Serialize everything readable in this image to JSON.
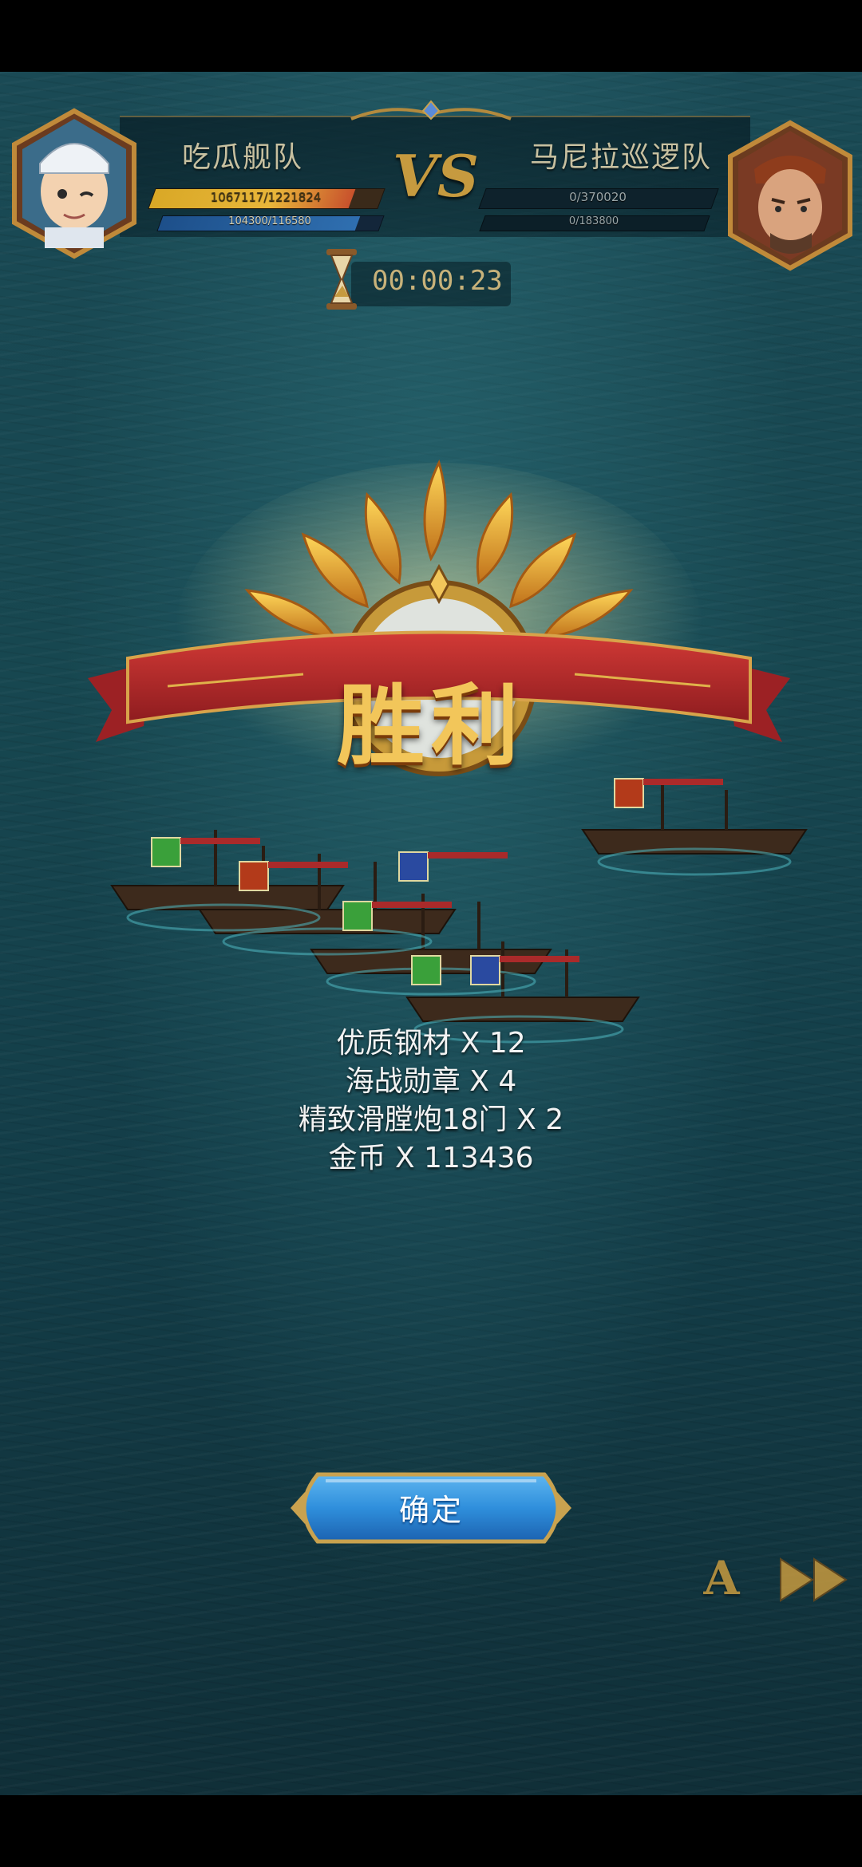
{
  "header": {
    "left_team": {
      "name": "吃瓜舰队",
      "hp_text": "1067117/1221824",
      "hp_fraction": 0.873,
      "sp_text": "104300/116580",
      "sp_fraction": 0.895,
      "avatar_icon": "chef-avatar-icon"
    },
    "vs_label": "VS",
    "right_team": {
      "name": "马尼拉巡逻队",
      "hp_text": "0/370020",
      "hp_fraction": 0,
      "sp_text": "0/183800",
      "sp_fraction": 0,
      "avatar_icon": "pirate-avatar-icon"
    }
  },
  "timer": {
    "value": "00:00:23",
    "icon": "hourglass-icon"
  },
  "result": {
    "title": "胜利"
  },
  "rewards": [
    {
      "text": "优质钢材 X 12"
    },
    {
      "text": "海战勋章 X 4"
    },
    {
      "text": "精致滑膛炮18门 X 2"
    },
    {
      "text": "金币 X 113436"
    }
  ],
  "confirm_button": {
    "label": "确定"
  },
  "controls": {
    "auto_label": "A",
    "speed_icon": "fast-forward-icon"
  },
  "colors": {
    "accent_gold": "#c69a3f",
    "banner_red": "#b3262b",
    "button_blue": "#2f8fdc"
  }
}
